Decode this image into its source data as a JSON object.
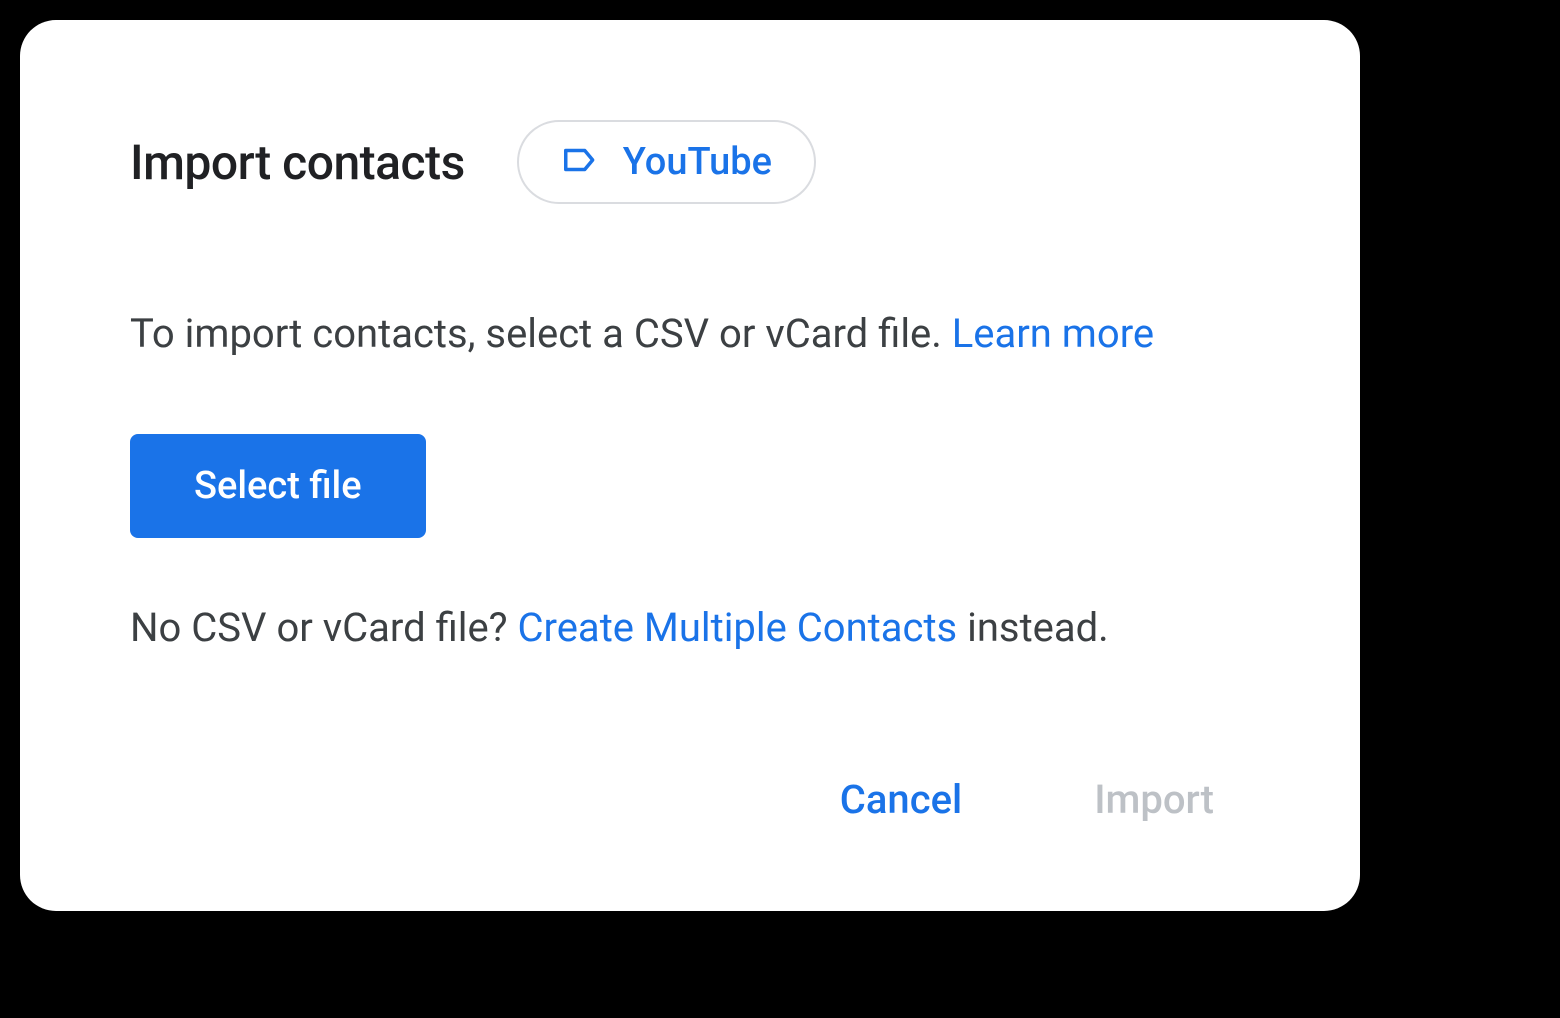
{
  "dialog": {
    "title": "Import contacts",
    "label_chip": "YouTube",
    "instruction_prefix": "To import contacts, select a CSV or vCard file. ",
    "learn_more": "Learn more",
    "select_file_button": "Select file",
    "alt_prefix": "No CSV or vCard file? ",
    "alt_link": "Create Multiple Contacts",
    "alt_suffix": " instead.",
    "cancel_button": "Cancel",
    "import_button": "Import"
  }
}
